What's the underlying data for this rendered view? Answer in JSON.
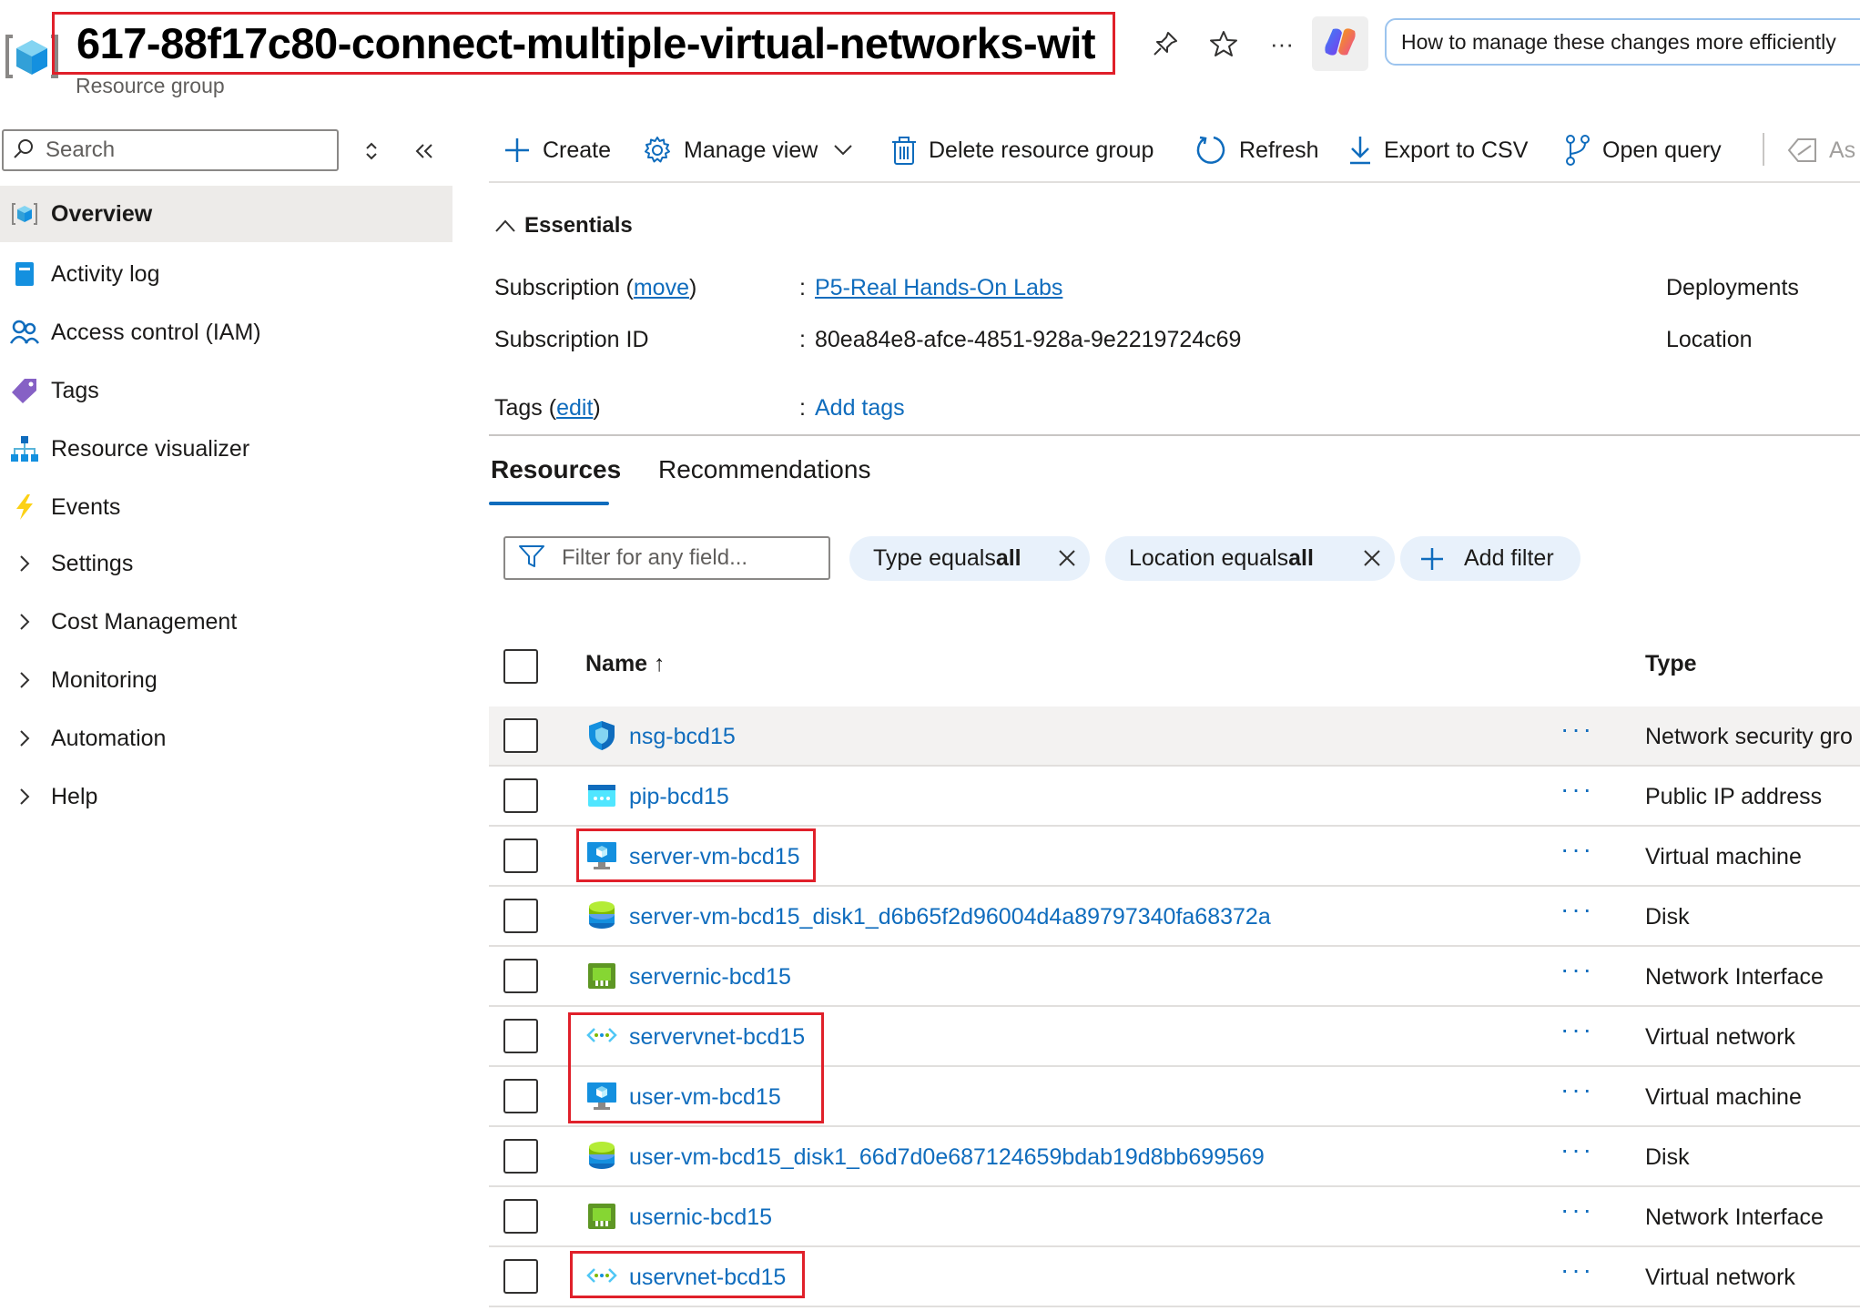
{
  "header": {
    "title": "617-88f17c80-connect-multiple-virtual-networks-wit",
    "subtitle": "Resource group",
    "copilot_prompt": "How to manage these changes more efficiently"
  },
  "icons": {
    "pin": "pin-icon",
    "favorite": "star-icon",
    "more": "more-icon",
    "copilot": "copilot-icon"
  },
  "nav": {
    "search_placeholder": "Search",
    "items": [
      {
        "label": "Overview",
        "icon": "resource-group-icon",
        "active": true
      },
      {
        "label": "Activity log",
        "icon": "activity-log-icon"
      },
      {
        "label": "Access control (IAM)",
        "icon": "people-icon"
      },
      {
        "label": "Tags",
        "icon": "tag-icon"
      },
      {
        "label": "Resource visualizer",
        "icon": "hierarchy-icon"
      },
      {
        "label": "Events",
        "icon": "lightning-icon"
      },
      {
        "label": "Settings",
        "icon": "chevron-right-icon"
      },
      {
        "label": "Cost Management",
        "icon": "chevron-right-icon"
      },
      {
        "label": "Monitoring",
        "icon": "chevron-right-icon"
      },
      {
        "label": "Automation",
        "icon": "chevron-right-icon"
      },
      {
        "label": "Help",
        "icon": "chevron-right-icon"
      }
    ]
  },
  "toolbar": {
    "create": "Create",
    "manage_view": "Manage view",
    "delete": "Delete resource group",
    "refresh": "Refresh",
    "export": "Export to CSV",
    "open_query": "Open query",
    "assign_tags_partial": "As"
  },
  "essentials": {
    "heading": "Essentials",
    "subscription_label": "Subscription (",
    "subscription_move": "move",
    "subscription_close": ")",
    "subscription_value": "P5-Real Hands-On Labs",
    "subscription_id_label": "Subscription ID",
    "subscription_id_value": "80ea84e8-afce-4851-928a-9e2219724c69",
    "tags_label": "Tags (",
    "tags_edit": "edit",
    "tags_close": ")",
    "tags_value": "Add tags",
    "colon": ":",
    "deployments_label": "Deployments",
    "location_label": "Location"
  },
  "tabs": {
    "resources": "Resources",
    "recommendations": "Recommendations"
  },
  "filters": {
    "placeholder": "Filter for any field...",
    "type_prefix": "Type equals ",
    "type_value": "all",
    "location_prefix": "Location equals ",
    "location_value": "all",
    "add_filter": "Add filter"
  },
  "table": {
    "col_name": "Name",
    "sort_indicator": "↑",
    "col_type": "Type",
    "more_label": "···",
    "rows": [
      {
        "name": "nsg-bcd15",
        "type": "Network security gro",
        "icon": "nsg-shield-icon"
      },
      {
        "name": "pip-bcd15",
        "type": "Public IP address",
        "icon": "public-ip-icon"
      },
      {
        "name": "server-vm-bcd15",
        "type": "Virtual machine",
        "icon": "vm-monitor-icon"
      },
      {
        "name": "server-vm-bcd15_disk1_d6b65f2d96004d4a89797340fa68372a",
        "type": "Disk",
        "icon": "disk-icon"
      },
      {
        "name": "servernic-bcd15",
        "type": "Network Interface",
        "icon": "nic-icon"
      },
      {
        "name": "servervnet-bcd15",
        "type": "Virtual network",
        "icon": "vnet-icon"
      },
      {
        "name": "user-vm-bcd15",
        "type": "Virtual machine",
        "icon": "vm-monitor-icon"
      },
      {
        "name": "user-vm-bcd15_disk1_66d7d0e687124659bdab19d8bb699569",
        "type": "Disk",
        "icon": "disk-icon"
      },
      {
        "name": "usernic-bcd15",
        "type": "Network Interface",
        "icon": "nic-icon"
      },
      {
        "name": "uservnet-bcd15",
        "type": "Virtual network",
        "icon": "vnet-icon"
      }
    ]
  },
  "colors": {
    "accent": "#0f6cbd",
    "highlight": "#e0202a",
    "pill_bg": "#e8f1fb"
  }
}
